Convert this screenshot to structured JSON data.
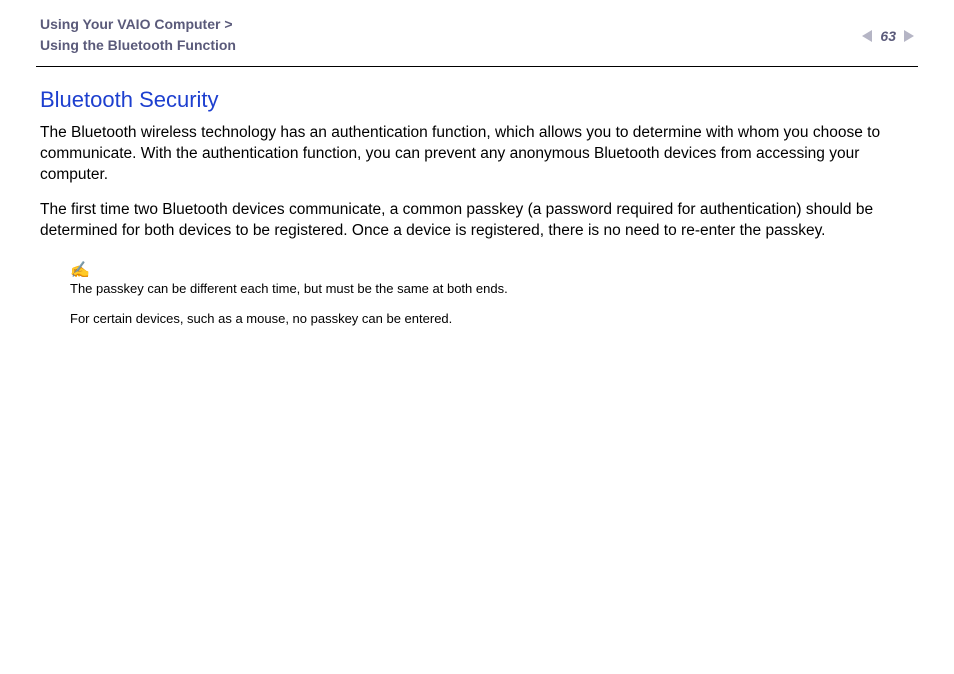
{
  "header": {
    "breadcrumb_line1": "Using Your VAIO Computer >",
    "breadcrumb_line2": "Using the Bluetooth Function",
    "page_number": "63"
  },
  "content": {
    "title": "Bluetooth Security",
    "para1": "The Bluetooth wireless technology has an authentication function, which allows you to determine with whom you choose to communicate. With the authentication function, you can prevent any anonymous Bluetooth devices from accessing your computer.",
    "para2": "The first time two Bluetooth devices communicate, a common passkey (a password required for authentication) should be determined for both devices to be registered. Once a device is registered, there is no need to re-enter the passkey.",
    "note_icon": "✍",
    "note1": "The passkey can be different each time, but must be the same at both ends.",
    "note2": "For certain devices, such as a mouse, no passkey can be entered."
  }
}
